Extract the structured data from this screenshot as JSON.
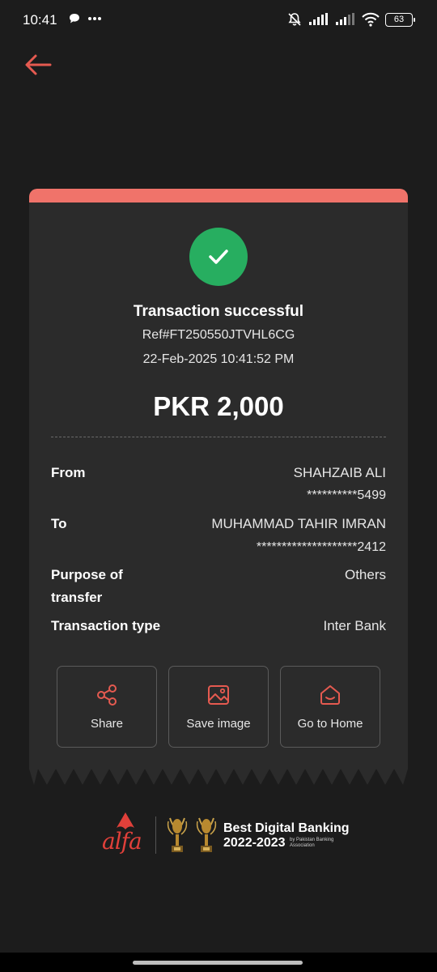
{
  "status_bar": {
    "time": "10:41",
    "battery": "63",
    "icons": [
      "message-bubble-icon",
      "more-dots-icon",
      "mute-bell-icon",
      "signal-icon",
      "signal-icon",
      "wifi-icon",
      "battery-icon"
    ]
  },
  "nav": {
    "back_icon": "arrow-left-icon"
  },
  "receipt": {
    "title": "Transaction successful",
    "ref": "Ref#FT250550JTVHL6CG",
    "datetime": "22-Feb-2025 10:41:52 PM",
    "amount": "PKR 2,000",
    "rows": {
      "from": {
        "label": "From",
        "name": "SHAHZAIB ALI",
        "account": "**********5499"
      },
      "to": {
        "label": "To",
        "name": "MUHAMMAD TAHIR IMRAN",
        "account": "********************2412"
      },
      "purpose": {
        "label_line1": "Purpose of",
        "label_line2": "transfer",
        "value": "Others"
      },
      "type": {
        "label": "Transaction type",
        "value": "Inter Bank"
      }
    },
    "actions": [
      {
        "label": "Share",
        "icon": "share-icon"
      },
      {
        "label": "Save image",
        "icon": "image-icon"
      },
      {
        "label": "Go to Home",
        "icon": "home-icon"
      }
    ]
  },
  "footer": {
    "brand": "alfa",
    "award_title": "Best Digital Banking",
    "award_years": "2022-2023",
    "award_sub": "by Pakistan Banking Association"
  },
  "colors": {
    "background": "#1c1c1c",
    "card": "#2b2b2b",
    "accent": "#f0736a",
    "success": "#27ae60",
    "brand_red": "#e0403a"
  }
}
